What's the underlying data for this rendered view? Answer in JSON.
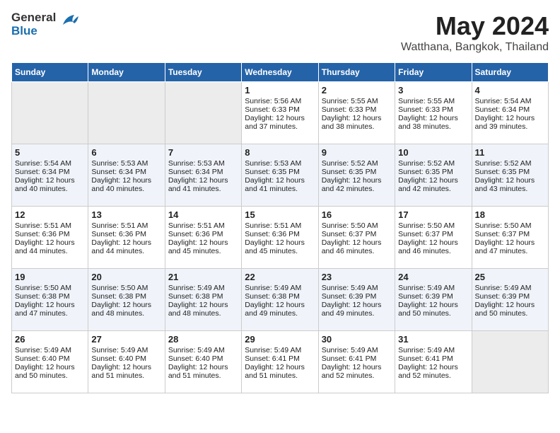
{
  "header": {
    "logo_general": "General",
    "logo_blue": "Blue",
    "month": "May 2024",
    "location": "Watthana, Bangkok, Thailand"
  },
  "weekdays": [
    "Sunday",
    "Monday",
    "Tuesday",
    "Wednesday",
    "Thursday",
    "Friday",
    "Saturday"
  ],
  "weeks": [
    [
      {
        "day": "",
        "empty": true
      },
      {
        "day": "",
        "empty": true
      },
      {
        "day": "",
        "empty": true
      },
      {
        "day": "1",
        "sunrise": "Sunrise: 5:56 AM",
        "sunset": "Sunset: 6:33 PM",
        "daylight": "Daylight: 12 hours and 37 minutes."
      },
      {
        "day": "2",
        "sunrise": "Sunrise: 5:55 AM",
        "sunset": "Sunset: 6:33 PM",
        "daylight": "Daylight: 12 hours and 38 minutes."
      },
      {
        "day": "3",
        "sunrise": "Sunrise: 5:55 AM",
        "sunset": "Sunset: 6:33 PM",
        "daylight": "Daylight: 12 hours and 38 minutes."
      },
      {
        "day": "4",
        "sunrise": "Sunrise: 5:54 AM",
        "sunset": "Sunset: 6:34 PM",
        "daylight": "Daylight: 12 hours and 39 minutes."
      }
    ],
    [
      {
        "day": "5",
        "sunrise": "Sunrise: 5:54 AM",
        "sunset": "Sunset: 6:34 PM",
        "daylight": "Daylight: 12 hours and 40 minutes."
      },
      {
        "day": "6",
        "sunrise": "Sunrise: 5:53 AM",
        "sunset": "Sunset: 6:34 PM",
        "daylight": "Daylight: 12 hours and 40 minutes."
      },
      {
        "day": "7",
        "sunrise": "Sunrise: 5:53 AM",
        "sunset": "Sunset: 6:34 PM",
        "daylight": "Daylight: 12 hours and 41 minutes."
      },
      {
        "day": "8",
        "sunrise": "Sunrise: 5:53 AM",
        "sunset": "Sunset: 6:35 PM",
        "daylight": "Daylight: 12 hours and 41 minutes."
      },
      {
        "day": "9",
        "sunrise": "Sunrise: 5:52 AM",
        "sunset": "Sunset: 6:35 PM",
        "daylight": "Daylight: 12 hours and 42 minutes."
      },
      {
        "day": "10",
        "sunrise": "Sunrise: 5:52 AM",
        "sunset": "Sunset: 6:35 PM",
        "daylight": "Daylight: 12 hours and 42 minutes."
      },
      {
        "day": "11",
        "sunrise": "Sunrise: 5:52 AM",
        "sunset": "Sunset: 6:35 PM",
        "daylight": "Daylight: 12 hours and 43 minutes."
      }
    ],
    [
      {
        "day": "12",
        "sunrise": "Sunrise: 5:51 AM",
        "sunset": "Sunset: 6:36 PM",
        "daylight": "Daylight: 12 hours and 44 minutes."
      },
      {
        "day": "13",
        "sunrise": "Sunrise: 5:51 AM",
        "sunset": "Sunset: 6:36 PM",
        "daylight": "Daylight: 12 hours and 44 minutes."
      },
      {
        "day": "14",
        "sunrise": "Sunrise: 5:51 AM",
        "sunset": "Sunset: 6:36 PM",
        "daylight": "Daylight: 12 hours and 45 minutes."
      },
      {
        "day": "15",
        "sunrise": "Sunrise: 5:51 AM",
        "sunset": "Sunset: 6:36 PM",
        "daylight": "Daylight: 12 hours and 45 minutes."
      },
      {
        "day": "16",
        "sunrise": "Sunrise: 5:50 AM",
        "sunset": "Sunset: 6:37 PM",
        "daylight": "Daylight: 12 hours and 46 minutes."
      },
      {
        "day": "17",
        "sunrise": "Sunrise: 5:50 AM",
        "sunset": "Sunset: 6:37 PM",
        "daylight": "Daylight: 12 hours and 46 minutes."
      },
      {
        "day": "18",
        "sunrise": "Sunrise: 5:50 AM",
        "sunset": "Sunset: 6:37 PM",
        "daylight": "Daylight: 12 hours and 47 minutes."
      }
    ],
    [
      {
        "day": "19",
        "sunrise": "Sunrise: 5:50 AM",
        "sunset": "Sunset: 6:38 PM",
        "daylight": "Daylight: 12 hours and 47 minutes."
      },
      {
        "day": "20",
        "sunrise": "Sunrise: 5:50 AM",
        "sunset": "Sunset: 6:38 PM",
        "daylight": "Daylight: 12 hours and 48 minutes."
      },
      {
        "day": "21",
        "sunrise": "Sunrise: 5:49 AM",
        "sunset": "Sunset: 6:38 PM",
        "daylight": "Daylight: 12 hours and 48 minutes."
      },
      {
        "day": "22",
        "sunrise": "Sunrise: 5:49 AM",
        "sunset": "Sunset: 6:38 PM",
        "daylight": "Daylight: 12 hours and 49 minutes."
      },
      {
        "day": "23",
        "sunrise": "Sunrise: 5:49 AM",
        "sunset": "Sunset: 6:39 PM",
        "daylight": "Daylight: 12 hours and 49 minutes."
      },
      {
        "day": "24",
        "sunrise": "Sunrise: 5:49 AM",
        "sunset": "Sunset: 6:39 PM",
        "daylight": "Daylight: 12 hours and 50 minutes."
      },
      {
        "day": "25",
        "sunrise": "Sunrise: 5:49 AM",
        "sunset": "Sunset: 6:39 PM",
        "daylight": "Daylight: 12 hours and 50 minutes."
      }
    ],
    [
      {
        "day": "26",
        "sunrise": "Sunrise: 5:49 AM",
        "sunset": "Sunset: 6:40 PM",
        "daylight": "Daylight: 12 hours and 50 minutes."
      },
      {
        "day": "27",
        "sunrise": "Sunrise: 5:49 AM",
        "sunset": "Sunset: 6:40 PM",
        "daylight": "Daylight: 12 hours and 51 minutes."
      },
      {
        "day": "28",
        "sunrise": "Sunrise: 5:49 AM",
        "sunset": "Sunset: 6:40 PM",
        "daylight": "Daylight: 12 hours and 51 minutes."
      },
      {
        "day": "29",
        "sunrise": "Sunrise: 5:49 AM",
        "sunset": "Sunset: 6:41 PM",
        "daylight": "Daylight: 12 hours and 51 minutes."
      },
      {
        "day": "30",
        "sunrise": "Sunrise: 5:49 AM",
        "sunset": "Sunset: 6:41 PM",
        "daylight": "Daylight: 12 hours and 52 minutes."
      },
      {
        "day": "31",
        "sunrise": "Sunrise: 5:49 AM",
        "sunset": "Sunset: 6:41 PM",
        "daylight": "Daylight: 12 hours and 52 minutes."
      },
      {
        "day": "",
        "empty": true
      }
    ]
  ]
}
